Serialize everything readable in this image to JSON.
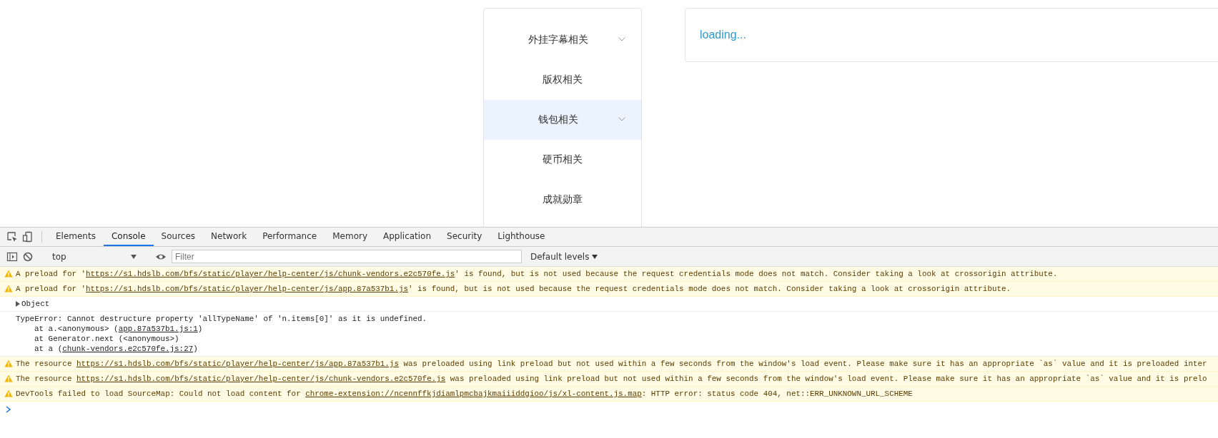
{
  "page": {
    "menu": [
      {
        "label": "外挂字幕相关",
        "expandable": true,
        "selected": false
      },
      {
        "label": "版权相关",
        "expandable": false,
        "selected": false
      },
      {
        "label": "钱包相关",
        "expandable": true,
        "selected": true
      },
      {
        "label": "硬币相关",
        "expandable": false,
        "selected": false
      },
      {
        "label": "成就勋章",
        "expandable": false,
        "selected": false
      }
    ],
    "content": {
      "status": "loading..."
    }
  },
  "devtools": {
    "tabs": [
      {
        "label": "Elements",
        "selected": false
      },
      {
        "label": "Console",
        "selected": true
      },
      {
        "label": "Sources",
        "selected": false
      },
      {
        "label": "Network",
        "selected": false
      },
      {
        "label": "Performance",
        "selected": false
      },
      {
        "label": "Memory",
        "selected": false
      },
      {
        "label": "Application",
        "selected": false
      },
      {
        "label": "Security",
        "selected": false
      },
      {
        "label": "Lighthouse",
        "selected": false
      }
    ],
    "context": "top",
    "filter": {
      "placeholder": "Filter"
    },
    "levels": "Default levels",
    "messages": [
      {
        "kind": "warning",
        "parts": [
          {
            "text": "A preload for '"
          },
          {
            "text": "https://s1.hdslb.com/bfs/static/player/help-center/js/chunk-vendors.e2c570fe.js",
            "link": true
          },
          {
            "text": "' is found, but is not used because the request credentials mode does not match. Consider taking a look at crossorigin attribute."
          }
        ]
      },
      {
        "kind": "warning",
        "parts": [
          {
            "text": "A preload for '"
          },
          {
            "text": "https://s1.hdslb.com/bfs/static/player/help-center/js/app.87a537b1.js",
            "link": true
          },
          {
            "text": "' is found, but is not used because the request credentials mode does not match. Consider taking a look at crossorigin attribute."
          }
        ]
      },
      {
        "kind": "object",
        "parts": [
          {
            "text": "Object"
          }
        ]
      },
      {
        "kind": "log",
        "parts": [
          {
            "text": "TypeError: Cannot destructure property 'allTypeName' of 'n.items[0]' as it is undefined."
          }
        ],
        "stack": [
          {
            "parts": [
              {
                "text": "at a.<anonymous> ("
              },
              {
                "text": "app.87a537b1.js:1",
                "link": true
              },
              {
                "text": ")"
              }
            ]
          },
          {
            "parts": [
              {
                "text": "at Generator.next (<anonymous>)"
              }
            ]
          },
          {
            "parts": [
              {
                "text": "at a ("
              },
              {
                "text": "chunk-vendors.e2c570fe.js:27",
                "link": true
              },
              {
                "text": ")"
              }
            ]
          }
        ]
      },
      {
        "kind": "warning",
        "parts": [
          {
            "text": "The resource "
          },
          {
            "text": "https://s1.hdslb.com/bfs/static/player/help-center/js/app.87a537b1.js",
            "link": true
          },
          {
            "text": " was preloaded using link preload but not used within a few seconds from the window's load event. Please make sure it has an appropriate `as` value and it is preloaded inter"
          }
        ]
      },
      {
        "kind": "warning",
        "parts": [
          {
            "text": "The resource "
          },
          {
            "text": "https://s1.hdslb.com/bfs/static/player/help-center/js/chunk-vendors.e2c570fe.js",
            "link": true
          },
          {
            "text": " was preloaded using link preload but not used within a few seconds from the window's load event. Please make sure it has an appropriate `as` value and it is prelo"
          }
        ]
      },
      {
        "kind": "warning",
        "parts": [
          {
            "text": "DevTools failed to load SourceMap: Could not load content for "
          },
          {
            "text": "chrome-extension://ncennffkjdiamlpmcbajkmaiiiddgioo/js/xl-content.js.map",
            "link": true
          },
          {
            "text": ": HTTP error: status code 404, net::ERR_UNKNOWN_URL_SCHEME"
          }
        ]
      }
    ]
  }
}
